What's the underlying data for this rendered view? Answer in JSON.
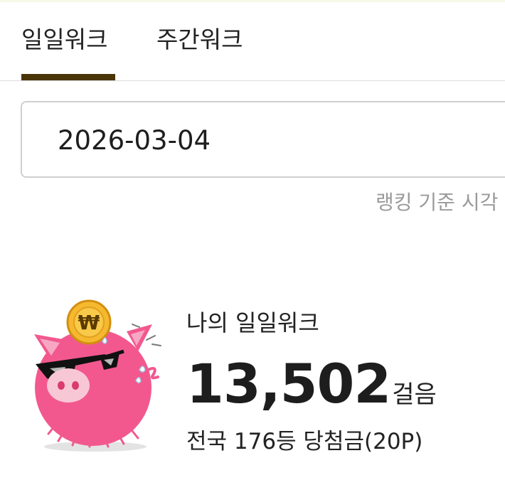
{
  "tabs": [
    {
      "label": "일일워크",
      "active": true
    },
    {
      "label": "주간워크",
      "active": false
    }
  ],
  "colors": {
    "active_tab_indicator": "#4a3508",
    "mascot_body": "#f2588e",
    "coin": "#f5b82e"
  },
  "date_field": {
    "value": "2026-03-04"
  },
  "ranking_note": "랭킹 기준 시각",
  "mascot": {
    "icon": "piggy-bank-mascot-with-won-coin",
    "coin_symbol": "₩"
  },
  "summary": {
    "title": "나의 일일워크",
    "steps": "13,502",
    "steps_unit": "걸음",
    "rank_text": "전국 176등 당첨금(20P)"
  }
}
